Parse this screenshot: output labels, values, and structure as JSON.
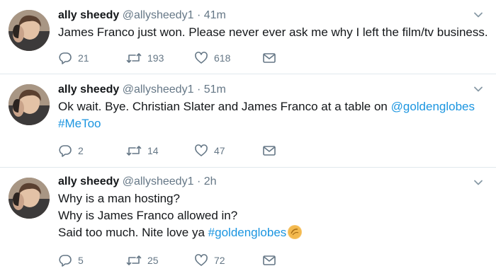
{
  "tweets": [
    {
      "name": "ally sheedy",
      "handle": "@allysheedy1",
      "dot": "·",
      "time": "41m",
      "lines": [
        [
          {
            "t": "James Franco just won. Please never ever ask me why I left the film/tv business.",
            "link": false
          }
        ]
      ],
      "replies": "21",
      "retweets": "193",
      "likes": "618"
    },
    {
      "name": "ally sheedy",
      "handle": "@allysheedy1",
      "dot": "·",
      "time": "51m",
      "lines": [
        [
          {
            "t": "Ok wait. Bye. Christian Slater and James Franco at a table on ",
            "link": false
          },
          {
            "t": "@goldenglobes",
            "link": true
          }
        ],
        [
          {
            "t": "#MeToo",
            "link": true
          }
        ]
      ],
      "replies": "2",
      "retweets": "14",
      "likes": "47"
    },
    {
      "name": "ally sheedy",
      "handle": "@allysheedy1",
      "dot": "·",
      "time": "2h",
      "lines": [
        [
          {
            "t": "Why is a man hosting?",
            "link": false
          }
        ],
        [
          {
            "t": "Why is James Franco allowed in?",
            "link": false
          }
        ],
        [
          {
            "t": "Said too much. Nite love ya ",
            "link": false
          },
          {
            "t": "#goldenglobes",
            "link": true
          }
        ]
      ],
      "replies": "5",
      "retweets": "25",
      "likes": "72"
    }
  ],
  "icons": {
    "reply": "reply-icon",
    "retweet": "retweet-icon",
    "like": "heart-icon",
    "dm": "envelope-icon",
    "caret": "chevron-down-icon",
    "emoji": "golden-globe-emoji-icon"
  },
  "colors": {
    "link": "#1b95e0",
    "secondary": "#657786",
    "divider": "#e1e8ed"
  }
}
